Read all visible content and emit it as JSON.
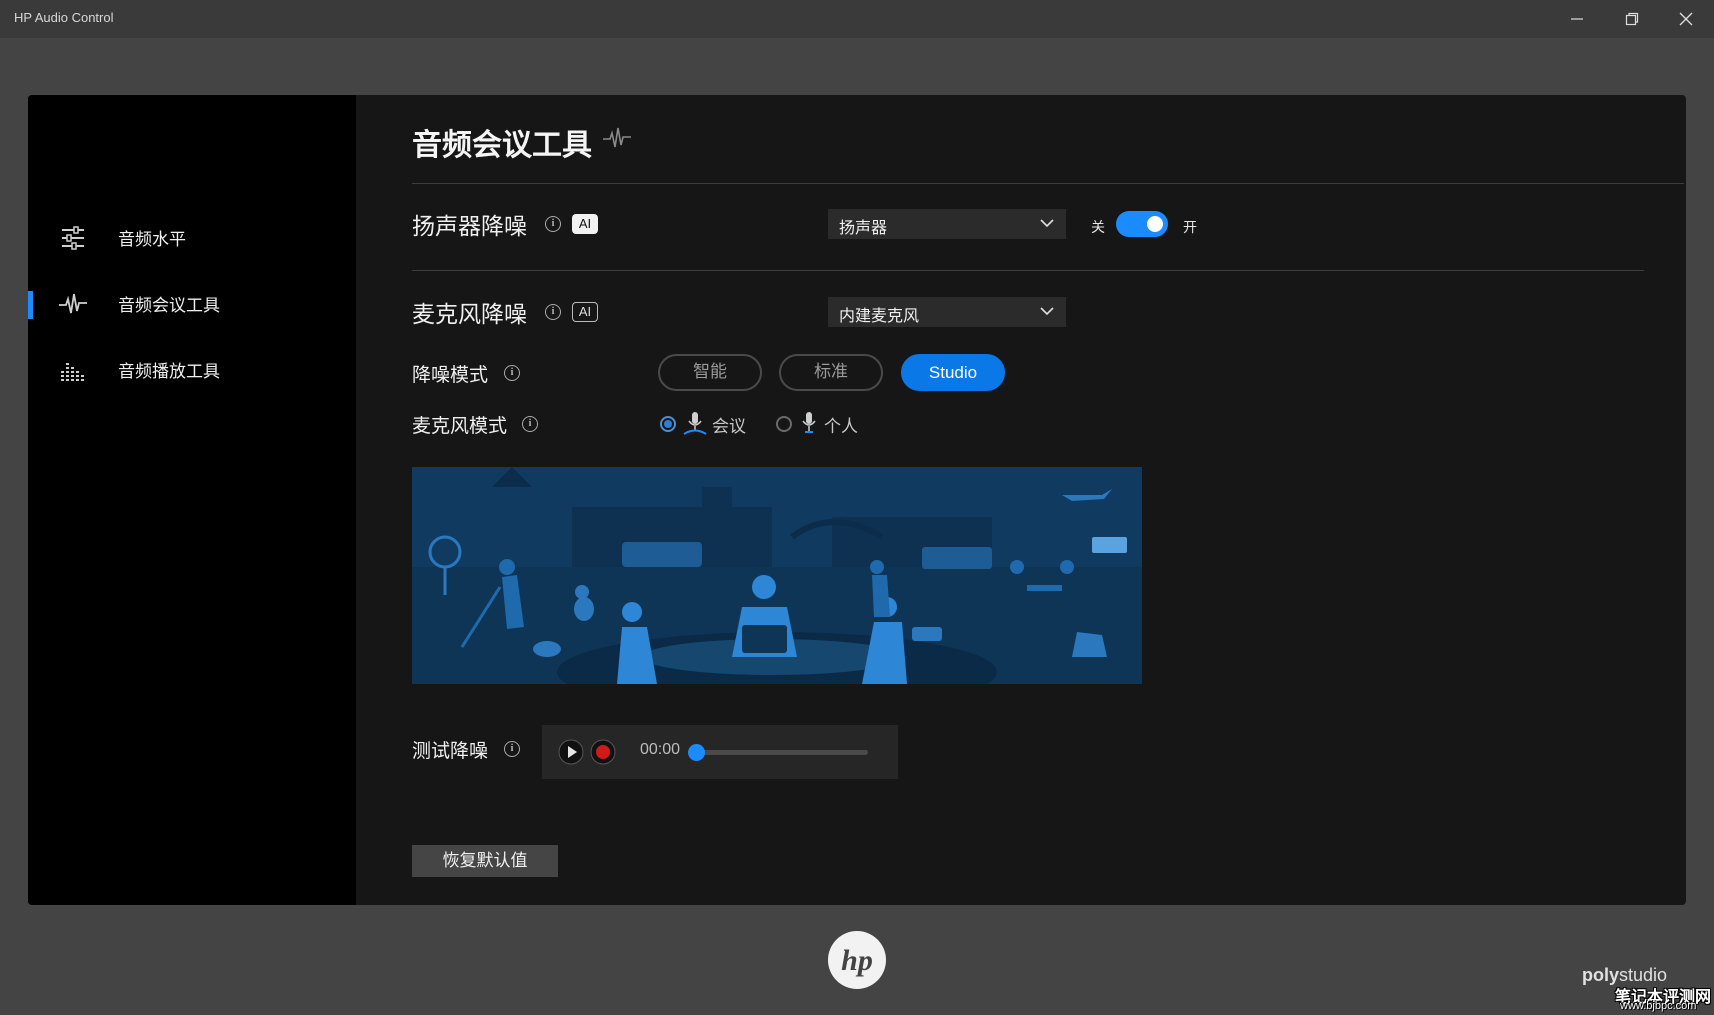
{
  "window": {
    "title": "HP Audio Control",
    "controls": [
      "minimize-icon",
      "restore-icon",
      "close-icon"
    ]
  },
  "sidebar": {
    "items": [
      {
        "label": "音频水平",
        "icon": "sliders-icon",
        "active": false
      },
      {
        "label": "音频会议工具",
        "icon": "waveform-icon",
        "active": true
      },
      {
        "label": "音频播放工具",
        "icon": "equalizer-bars-icon",
        "active": false
      }
    ]
  },
  "main": {
    "title": "音频会议工具",
    "title_icon": "waveform-icon",
    "speaker_noise": {
      "title": "扬声器降噪",
      "badge": "AI",
      "device": "扬声器",
      "toggle_off_label": "关",
      "toggle_on_label": "开",
      "enabled": true
    },
    "mic_noise": {
      "title": "麦克风降噪",
      "badge": "AI",
      "device": "内建麦克风"
    },
    "noise_mode": {
      "label": "降噪模式",
      "options": [
        "智能",
        "标准",
        "Studio"
      ],
      "selected": "Studio"
    },
    "mic_mode": {
      "label": "麦克风模式",
      "options": [
        "会议",
        "个人"
      ],
      "selected": "会议"
    },
    "test": {
      "label": "测试降噪",
      "time": "00:00",
      "progress": 0
    },
    "reset_label": "恢复默认值"
  },
  "footer": {
    "brand": "hp",
    "poly_bold": "poly",
    "poly_light": "studio",
    "watermark": "笔记本评测网",
    "watermark_url": "www.bjbpc.com"
  },
  "colors": {
    "accent": "#1a8cff",
    "record": "#d01a1a",
    "background": "#444444",
    "panel": "#161616",
    "sidebar": "#000000"
  }
}
